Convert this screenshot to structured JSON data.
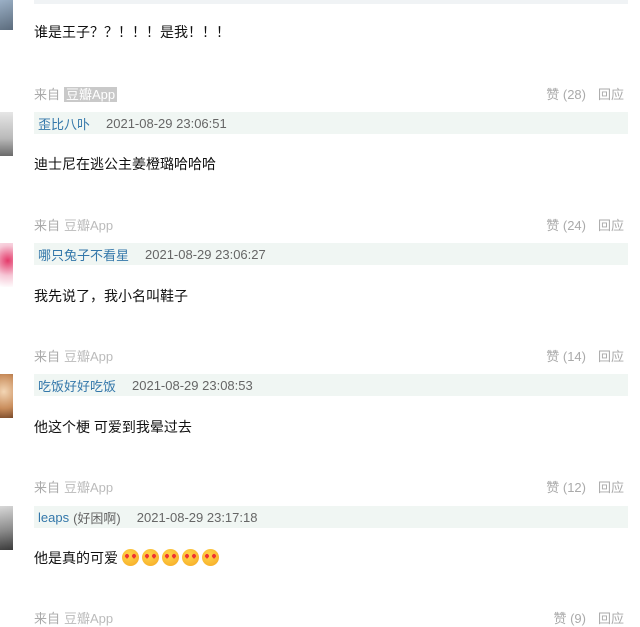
{
  "comments": [
    {
      "text": "谁是王子？？！！！是我！！！",
      "source_prefix": "来自",
      "source_app": "豆瓣App",
      "vote": "赞 (28)",
      "reply": "回应"
    },
    {
      "author": "歪比八卟",
      "time": "2021-08-29 23:06:51",
      "text": "迪士尼在逃公主姜橙璐哈哈哈",
      "source_prefix": "来自",
      "source_app": "豆瓣App",
      "vote": "赞 (24)",
      "reply": "回应"
    },
    {
      "author": "哪只兔子不看星",
      "time": "2021-08-29 23:06:27",
      "text": "我先说了，我小名叫鞋子",
      "source_prefix": "来自",
      "source_app": "豆瓣App",
      "vote": "赞 (14)",
      "reply": "回应"
    },
    {
      "author": "吃饭好好吃饭",
      "time": "2021-08-29 23:08:53",
      "text": "他这个梗 可爱到我晕过去",
      "source_prefix": "来自",
      "source_app": "豆瓣App",
      "vote": "赞 (12)",
      "reply": "回应"
    },
    {
      "author": "leaps",
      "author_extra": "(好困啊)",
      "time": "2021-08-29 23:17:18",
      "text": "他是真的可爱",
      "source_prefix": "来自",
      "source_app": "豆瓣App",
      "vote": "赞 (9)",
      "reply": "回应"
    }
  ],
  "emoji_count_text": "5 smiling-face-with-heart-eyes",
  "colors": {
    "author_link": "#3377aa",
    "author_bar_bg": "#f0f6f3",
    "meta_gray": "#aaaaaa"
  }
}
